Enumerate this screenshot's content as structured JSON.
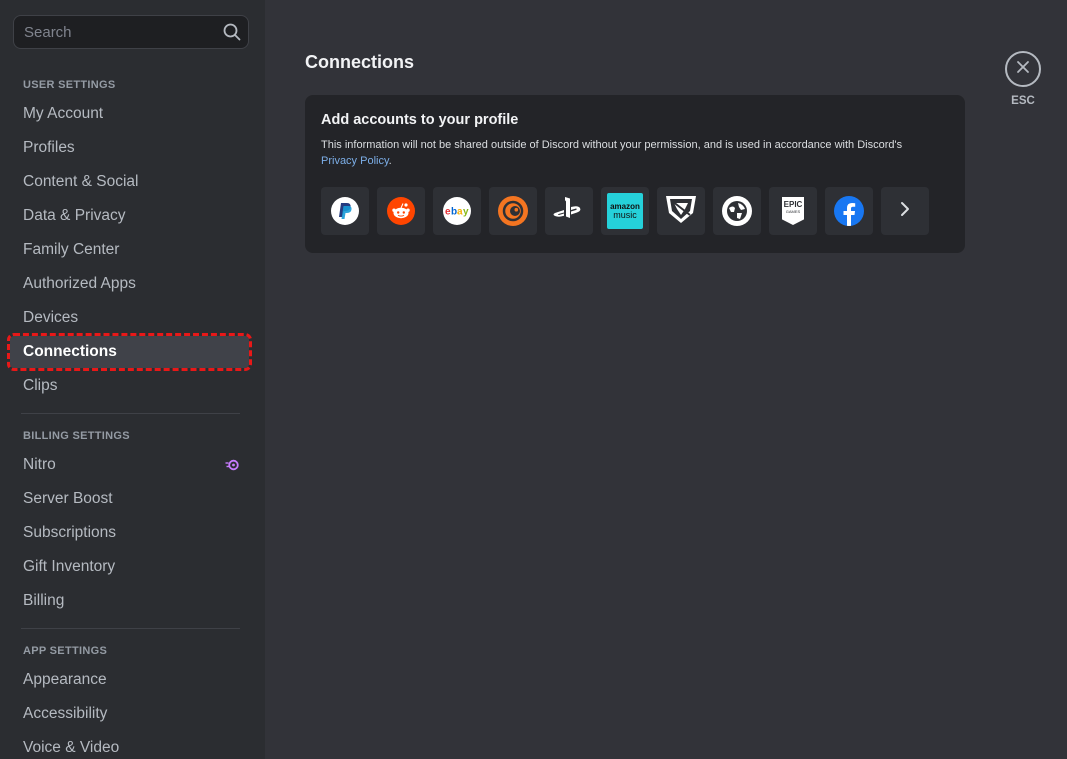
{
  "search": {
    "placeholder": "Search",
    "value": ""
  },
  "sidebar": {
    "user_settings_header": "USER SETTINGS",
    "user_items": [
      {
        "label": "My Account"
      },
      {
        "label": "Profiles"
      },
      {
        "label": "Content & Social"
      },
      {
        "label": "Data & Privacy"
      },
      {
        "label": "Family Center"
      },
      {
        "label": "Authorized Apps"
      },
      {
        "label": "Devices"
      },
      {
        "label": "Connections",
        "selected": true
      },
      {
        "label": "Clips"
      }
    ],
    "billing_settings_header": "BILLING SETTINGS",
    "billing_items": [
      {
        "label": "Nitro",
        "icon": "nitro-icon"
      },
      {
        "label": "Server Boost"
      },
      {
        "label": "Subscriptions"
      },
      {
        "label": "Gift Inventory"
      },
      {
        "label": "Billing"
      }
    ],
    "app_settings_header": "APP SETTINGS",
    "app_items": [
      {
        "label": "Appearance"
      },
      {
        "label": "Accessibility"
      },
      {
        "label": "Voice & Video"
      }
    ]
  },
  "main": {
    "title": "Connections",
    "card": {
      "title": "Add accounts to your profile",
      "description": "This information will not be shared outside of Discord without your permission, and is used in accordance with Discord's",
      "link": "Privacy Policy",
      "link_suffix": "."
    },
    "services": [
      {
        "name": "paypal-icon"
      },
      {
        "name": "reddit-icon"
      },
      {
        "name": "ebay-icon",
        "text": "ebay"
      },
      {
        "name": "crunchyroll-icon"
      },
      {
        "name": "playstation-icon"
      },
      {
        "name": "amazon-music-icon",
        "text1": "amazon",
        "text2": "music"
      },
      {
        "name": "bungie-icon"
      },
      {
        "name": "domain-globe-icon"
      },
      {
        "name": "epic-games-icon",
        "text1": "EPIC",
        "text2": "GAMES"
      },
      {
        "name": "facebook-icon"
      },
      {
        "name": "chevron-right-icon"
      }
    ]
  },
  "close": {
    "label": "ESC"
  },
  "colors": {
    "accent_link": "#7caee7",
    "selection_outline": "#e81818",
    "nitro": "#c77cff",
    "reddit": "#ff4500",
    "crunchyroll": "#f47521",
    "amazon_music": "#25d1da",
    "facebook": "#1877f2"
  }
}
